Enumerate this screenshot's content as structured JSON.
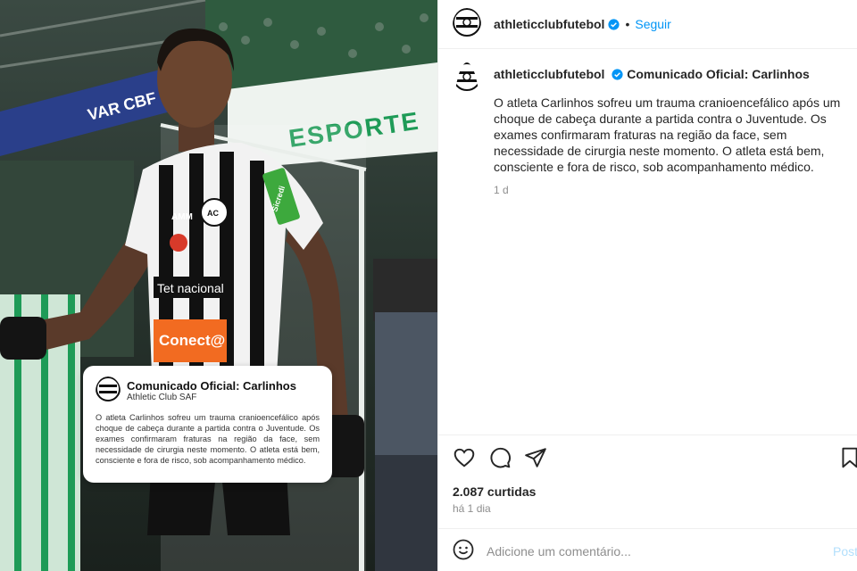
{
  "post": {
    "username": "athleticclubfutebol",
    "follow_label": "Seguir",
    "separator": "•",
    "caption": {
      "title": "Comunicado Oficial: Carlinhos",
      "body": "O atleta Carlinhos sofreu um trauma cranioencefálico após um choque de cabeça durante a partida contra o Juventude. Os exames confirmaram fraturas na região da face, sem necessidade de cirurgia neste momento. O atleta está bem, consciente e fora de risco, sob acompanhamento médico.",
      "time": "1 d"
    },
    "likes": "2.087 curtidas",
    "time_ago": "há 1 dia",
    "comment": {
      "placeholder": "Adicione um comentário...",
      "post_label": "Post"
    },
    "icons": [
      "heart-icon",
      "comment-icon",
      "share-icon",
      "bookmark-icon",
      "emoji-icon",
      "verified-badge-icon"
    ]
  },
  "image": {
    "stadium_signs": [
      "VAR",
      "CBF",
      "ESPORTE"
    ],
    "jersey_sponsors": [
      "Sicredi",
      "AMM",
      "Tet nacional",
      "Conect@"
    ],
    "card": {
      "title": "Comunicado Oficial: Carlinhos",
      "subtitle": "Athletic Club SAF",
      "body": "O atleta Carlinhos sofreu um trauma cranioencefálico após choque de cabeça durante a partida contra o Juventude. Os exames confirmaram fraturas na região da face, sem necessidade de cirurgia neste momento. O atleta está bem, consciente e fora de risco, sob acompanhamento médico."
    }
  },
  "colors": {
    "accent": "#0095f6",
    "muted": "#8e8e8e",
    "text": "#262626",
    "pitch_green": "#1e9b57"
  }
}
